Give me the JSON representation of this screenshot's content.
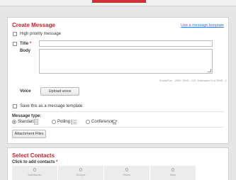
{
  "create_message": {
    "title": "Create Message",
    "template_link": "Use a message template",
    "high_priority_label": "High priority message",
    "title_label": "Title",
    "required_marker": "*",
    "title_value": "",
    "body_label": "Body",
    "body_value": "",
    "counter_text": "Email/Fax - 2000, SMS - 120, Estimated # of SMS - 1",
    "voice_label": "Voice",
    "upload_voice_label": "Upload voice",
    "save_template_label": "Save this as a message template",
    "message_type_label": "Message type:",
    "types": {
      "standard": "Standard",
      "polling": "Polling",
      "conference": "Conference"
    },
    "selected_type": "Standard",
    "attachment_label": "Attachment Files"
  },
  "select_contacts": {
    "title": "Select Contacts",
    "click_label": "Click to add contacts",
    "required_marker": "*",
    "stats": [
      {
        "value": "0",
        "caption": "Individuals"
      },
      {
        "value": "0",
        "caption": "Groups"
      },
      {
        "value": "0",
        "caption": "Rules"
      },
      {
        "value": "0",
        "caption": "Map"
      }
    ]
  },
  "colors": {
    "accent": "#c8232c",
    "link": "#3a79b9"
  },
  "icons": {
    "standard": "document-icon",
    "polling": "list-icon",
    "conference": "phone-icon"
  }
}
